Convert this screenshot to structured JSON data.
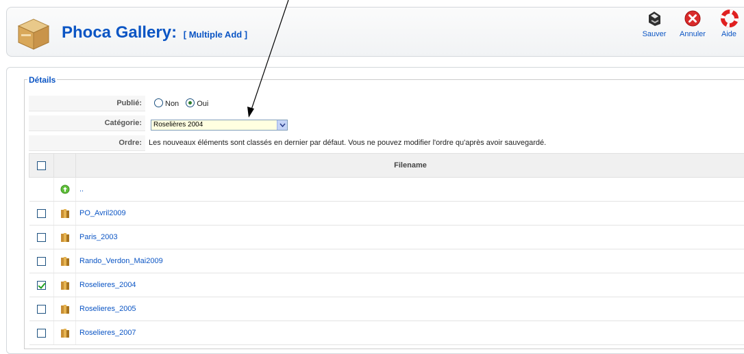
{
  "header": {
    "title": "Phoca Gallery:",
    "subtitle": "[ Multiple Add ]"
  },
  "toolbar": {
    "save_label": "Sauver",
    "cancel_label": "Annuler",
    "help_label": "Aide"
  },
  "details": {
    "legend": "Détails",
    "published": {
      "label": "Publié:",
      "options": [
        "Non",
        "Oui"
      ],
      "selected": "Oui"
    },
    "category": {
      "label": "Catégorie:",
      "selected": "Roselières 2004"
    },
    "order": {
      "label": "Ordre:",
      "text": "Les nouveaux éléments sont classés en dernier par défaut. Vous ne pouvez modifier l'ordre qu'après avoir sauvegardé."
    }
  },
  "table": {
    "header": "Filename",
    "up_label": "..",
    "rows": [
      {
        "name": "PO_Avril2009",
        "checked": false
      },
      {
        "name": "Paris_2003",
        "checked": false
      },
      {
        "name": "Rando_Verdon_Mai2009",
        "checked": false
      },
      {
        "name": "Roselieres_2004",
        "checked": true
      },
      {
        "name": "Roselieres_2005",
        "checked": false
      },
      {
        "name": "Roselieres_2007",
        "checked": false
      }
    ]
  },
  "colors": {
    "link": "#0b55c4",
    "checkmark": "#21a121",
    "select_bg": "#ffffe0"
  }
}
